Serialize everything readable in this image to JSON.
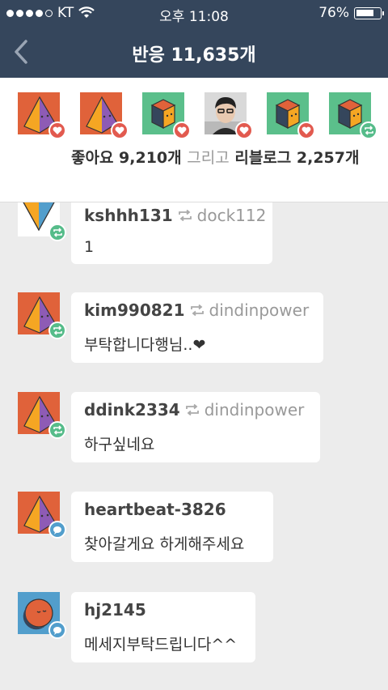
{
  "status": {
    "carrier": "KT",
    "time": "오후 11:08",
    "battery": "76%",
    "battery_level": 0.76,
    "signal_bars": 4
  },
  "nav": {
    "title": "반응 11,635개"
  },
  "header": {
    "avatars": [
      {
        "kind": "pyramid",
        "bg": "#e0623a",
        "badge": "like"
      },
      {
        "kind": "pyramid",
        "bg": "#e0623a",
        "badge": "like"
      },
      {
        "kind": "cube",
        "bg": "#5bbf8b",
        "badge": "like"
      },
      {
        "kind": "photo",
        "bg": "#d8d8d8",
        "badge": "like"
      },
      {
        "kind": "cube",
        "bg": "#5bbf8b",
        "badge": "like"
      },
      {
        "kind": "cube",
        "bg": "#5bbf8b",
        "badge": "reblog"
      }
    ],
    "likes_text": "좋아요 9,210개",
    "and_text": "그리고",
    "reblogs_text": "리블로그 2,257개"
  },
  "items": [
    {
      "user": "kshhh131",
      "via": "dock112",
      "message": "1",
      "type": "reblog",
      "avatar": "triangle-down"
    },
    {
      "user": "kim990821",
      "via": "dindinpower",
      "message": "부탁합니다행님..❤",
      "type": "reblog",
      "avatar": "pyramid"
    },
    {
      "user": "ddink2334",
      "via": "dindinpower",
      "message": "하구싶네요",
      "type": "reblog",
      "avatar": "pyramid"
    },
    {
      "user": "heartbeat-3826",
      "via": "",
      "message": "찾아갈게요 하게해주세요",
      "type": "comment",
      "avatar": "pyramid"
    },
    {
      "user": "hj2145",
      "via": "",
      "message": "메세지부탁드립니다^^",
      "type": "comment",
      "avatar": "moon"
    }
  ],
  "colors": {
    "nav_bg": "#35465c",
    "like": "#e25a4f",
    "reblog": "#56bc8a",
    "comment": "#529ecc"
  }
}
